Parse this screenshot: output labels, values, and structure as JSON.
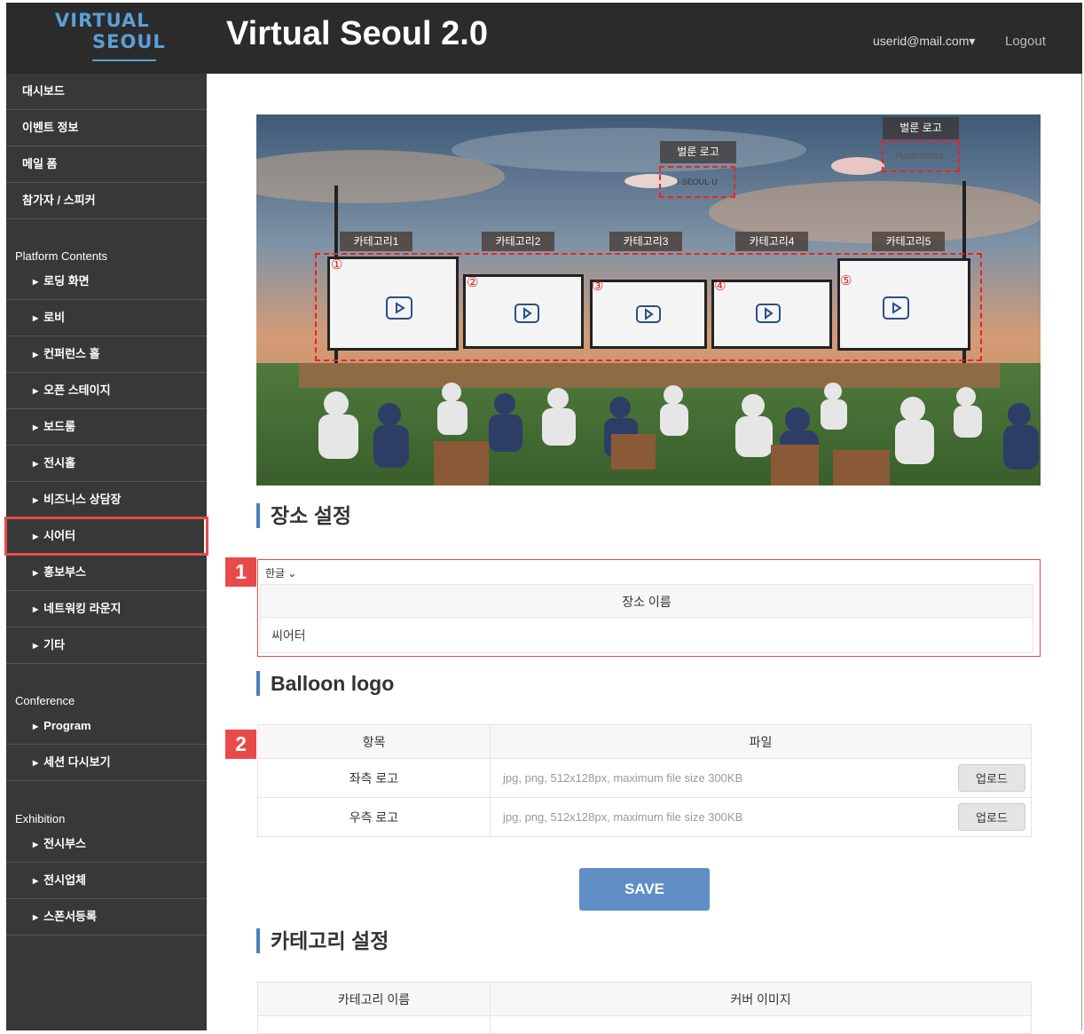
{
  "header": {
    "logo_line1": "VIRTUAL",
    "logo_line2": "SEOUL",
    "title": "Virtual Seoul 2.0",
    "user": "userid@mail.com▾",
    "logout": "Logout"
  },
  "sidebar": {
    "top_items": [
      "대시보드",
      "이벤트 정보",
      "메일 폼",
      "참가자 / 스피커"
    ],
    "platform_title": "Platform Contents",
    "platform_items": [
      "로딩 화면",
      "로비",
      "컨퍼런스 홀",
      "오픈 스테이지",
      "보드룸",
      "전시홀",
      "비즈니스 상담장",
      "시어터",
      "홍보부스",
      "네트워킹 라운지",
      "기타"
    ],
    "conference_title": "Conference",
    "conference_items": [
      "Program",
      "세션 다시보기"
    ],
    "exhibition_title": "Exhibition",
    "exhibition_items": [
      "전시부스",
      "전시업체",
      "스폰서등록"
    ],
    "active_item": "시어터"
  },
  "hero": {
    "balloon_label": "벌룬 로고",
    "balloon_left_logo": "I·SEOUL·U",
    "balloon_right_logo": "PLUS SEOUL",
    "categories": [
      "카테고리1",
      "카테고리2",
      "카테고리3",
      "카테고리4",
      "카테고리5"
    ],
    "screen_numbers": [
      "①",
      "②",
      "③",
      "④",
      "⑤"
    ]
  },
  "venue": {
    "title": "장소 설정",
    "badge": "1",
    "language": "한글 ⌄",
    "column": "장소 이름",
    "value": "씨어터"
  },
  "balloon": {
    "title": "Balloon logo",
    "badge": "2",
    "col_item": "항목",
    "col_file": "파일",
    "rows": [
      {
        "label": "좌측 로고",
        "hint": "jpg, png, 512x128px, maximum file size 300KB",
        "button": "업로드"
      },
      {
        "label": "우측 로고",
        "hint": "jpg, png, 512x128px, maximum file size 300KB",
        "button": "업로드"
      }
    ]
  },
  "save_label": "SAVE",
  "category": {
    "title": "카테고리 설정",
    "col_name": "카테고리 이름",
    "col_cover": "커버 이미지"
  }
}
